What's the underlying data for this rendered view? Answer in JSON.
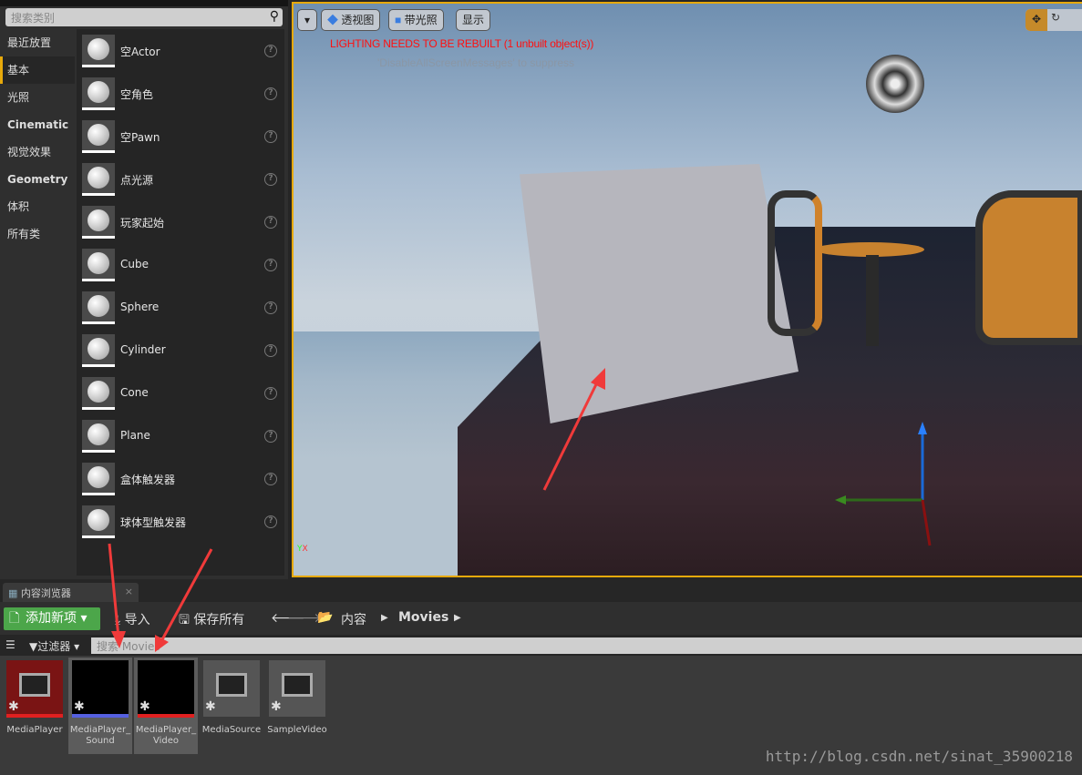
{
  "place_panel": {
    "search_placeholder": "搜索类别",
    "categories": [
      {
        "label": "最近放置"
      },
      {
        "label": "基本",
        "selected": true
      },
      {
        "label": "光照"
      },
      {
        "label": "Cinematic"
      },
      {
        "label": "视觉效果"
      },
      {
        "label": "Geometry"
      },
      {
        "label": "体积"
      },
      {
        "label": "所有类"
      }
    ],
    "items": [
      "空Actor",
      "空角色",
      "空Pawn",
      "点光源",
      "玩家起始",
      "Cube",
      "Sphere",
      "Cylinder",
      "Cone",
      "Plane",
      "盒体触发器",
      "球体型触发器"
    ]
  },
  "viewport": {
    "buttons": [
      "透视图",
      "带光照",
      "显示"
    ],
    "warning": "LIGHTING NEEDS TO BE REBUILT (1 unbuilt object(s))",
    "hint": "'DisableAllScreenMessages' to suppress",
    "accent": "#e7a90b"
  },
  "content_browser": {
    "tab": "内容浏览器",
    "add_new": "添加新项",
    "import": "导入",
    "save_all": "保存所有",
    "breadcrumb": [
      "内容",
      "Movies"
    ],
    "filter": "过滤器",
    "search_placeholder": "搜索 Movies",
    "assets": [
      {
        "name": "MediaPlayer",
        "bar": "#e02020"
      },
      {
        "name": "MediaPlayer_Sound",
        "bar": "#5560e0",
        "selected": true
      },
      {
        "name": "MediaPlayer_Video",
        "bar": "#e02020",
        "selected": true
      },
      {
        "name": "MediaSource",
        "bar": ""
      },
      {
        "name": "SampleVideo",
        "bar": ""
      }
    ]
  },
  "watermark": "http://blog.csdn.net/sinat_35900218"
}
